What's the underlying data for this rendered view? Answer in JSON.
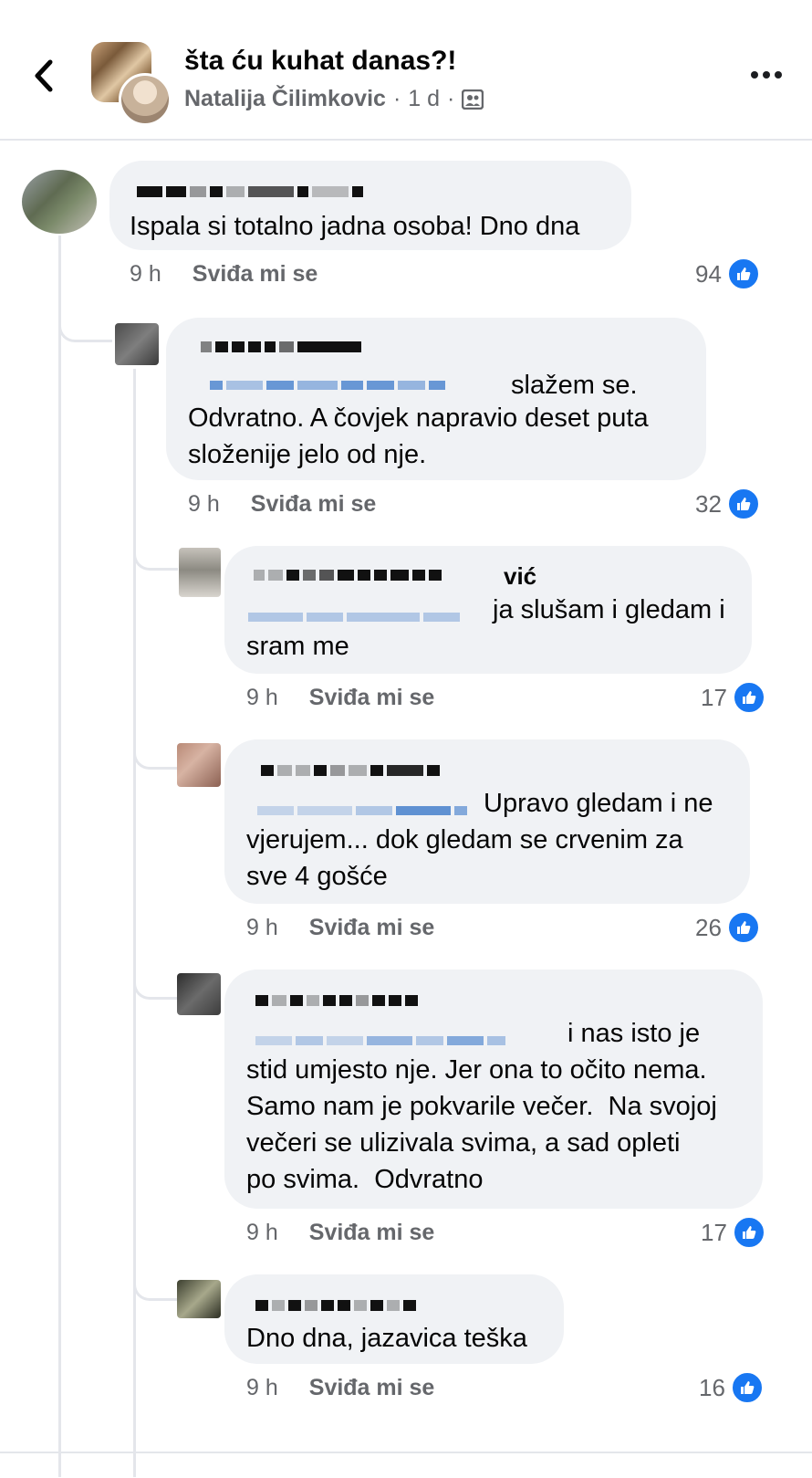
{
  "header": {
    "title": "šta ću kuhat danas?!",
    "author": "Natalija Čilimkovic",
    "time": "1 d",
    "separator": "·"
  },
  "comments": [
    {
      "author_suffix": "",
      "text": "Ispala si totalno jadna osoba! Dno dna",
      "time": "9 h",
      "like_label": "Sviđa mi se",
      "reactions": "94"
    },
    {
      "author_suffix": "",
      "text_line1": "slažem se.",
      "text_rest": "Odvratno. A čovjek napravio deset puta\nsloženije jelo od nje.",
      "time": "9 h",
      "like_label": "Sviđa mi se",
      "reactions": "32"
    },
    {
      "author_suffix": "vić",
      "text_line1": "ja slušam i gledam i",
      "text_rest": "sram me",
      "time": "9 h",
      "like_label": "Sviđa mi se",
      "reactions": "17"
    },
    {
      "author_suffix": "",
      "text_line1": "Upravo gledam i ne",
      "text_rest": "vjerujem... dok gledam se crvenim za\nsve 4 gošće",
      "time": "9 h",
      "like_label": "Sviđa mi se",
      "reactions": "26"
    },
    {
      "author_suffix": "",
      "text_line1": "i nas isto je",
      "text_rest": "stid umjesto nje. Jer ona to očito nema.\nSamo nam je pokvarile večer.  Na svojoj\nvečeri se ulizivala svima, a sad opleti\npo svima.  Odvratno",
      "time": "9 h",
      "like_label": "Sviđa mi se",
      "reactions": "17"
    },
    {
      "author_suffix": "",
      "text": "Dno dna, jazavica teška",
      "time": "9 h",
      "like_label": "Sviđa mi se",
      "reactions": "16"
    }
  ],
  "icons": {
    "back": "chevron-left-icon",
    "more": "more-horizontal-icon",
    "group_privacy": "members-icon",
    "like": "thumbs-up-icon"
  },
  "colors": {
    "bubble": "#f0f2f5",
    "meta": "#65676b",
    "like_blue": "#1877f2",
    "thread_line": "#e4e6eb"
  }
}
